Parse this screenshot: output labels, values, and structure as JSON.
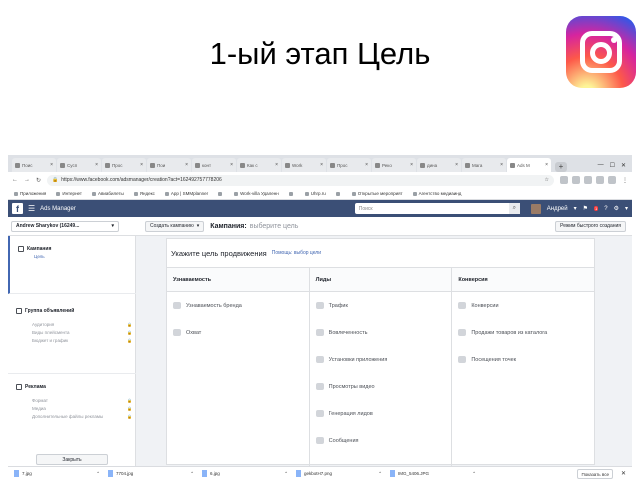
{
  "slide": {
    "title": "1-ый этап Цель"
  },
  "browser": {
    "tabs": [
      {
        "label": "Поис"
      },
      {
        "label": "Сусп"
      },
      {
        "label": "Прос"
      },
      {
        "label": "Пои"
      },
      {
        "label": "конт"
      },
      {
        "label": "Как с"
      },
      {
        "label": "Work"
      },
      {
        "label": "Прос"
      },
      {
        "label": "Реко"
      },
      {
        "label": "дина"
      },
      {
        "label": "Мага"
      },
      {
        "label": "Ads M",
        "active": true
      }
    ],
    "new_tab": "+",
    "window_controls": [
      "—",
      "☐",
      "✕"
    ],
    "url": "https://www.facebook.com/adsmanager/creation?act=162492757778206",
    "bookmarks": [
      "Приложения",
      "Интернет",
      "Авиабилеты",
      "Яндекс",
      "App | SMMplanner",
      "",
      "Work-villa Удаленн",
      "",
      "Uhrp.ru",
      "",
      "Открытые мероприят",
      "Агентство медиаинд"
    ]
  },
  "fb": {
    "logo": "f",
    "title": "Ads Manager",
    "search_placeholder": "Поиск",
    "user": "Андрей",
    "notif_count": "1"
  },
  "subheader": {
    "account": "Andrew Sharykov (16249...",
    "create_button": "Создать кампанию",
    "crumb_bold": "Кампания:",
    "crumb_normal": "выберите цель",
    "quick_button": "Режим быстрого создания"
  },
  "sidebar": {
    "campaign": {
      "title": "Кампания",
      "items": [
        "Цель"
      ]
    },
    "adset": {
      "title": "Группа объявлений",
      "items": [
        "Аудитория",
        "Виды плейсмента",
        "Бюджет и график"
      ]
    },
    "ad": {
      "title": "Реклама",
      "items": [
        "Формат",
        "Медиа",
        "Дополнительные файлы рекламы"
      ]
    },
    "close_button": "Закрыть"
  },
  "main": {
    "title": "Укажите цель продвижения",
    "help": "Помощь: выбор цели",
    "columns": [
      {
        "head": "Узнаваемость",
        "options": [
          "Узнаваемость бренда",
          "Охват"
        ]
      },
      {
        "head": "Лиды",
        "options": [
          "Трафик",
          "Вовлеченность",
          "Установки приложения",
          "Просмотры видео",
          "Генерация лидов",
          "Сообщения"
        ]
      },
      {
        "head": "Конверсия",
        "options": [
          "Конверсии",
          "Продажи товаров из каталога",
          "Посещения точек"
        ]
      }
    ]
  },
  "downloads": {
    "files": [
      "7.jpg",
      "7704.jpg",
      "6.jpg",
      "gekbotH7.png",
      "IMG_5406.JPG"
    ],
    "show_all": "Показать все",
    "close": "✕"
  }
}
